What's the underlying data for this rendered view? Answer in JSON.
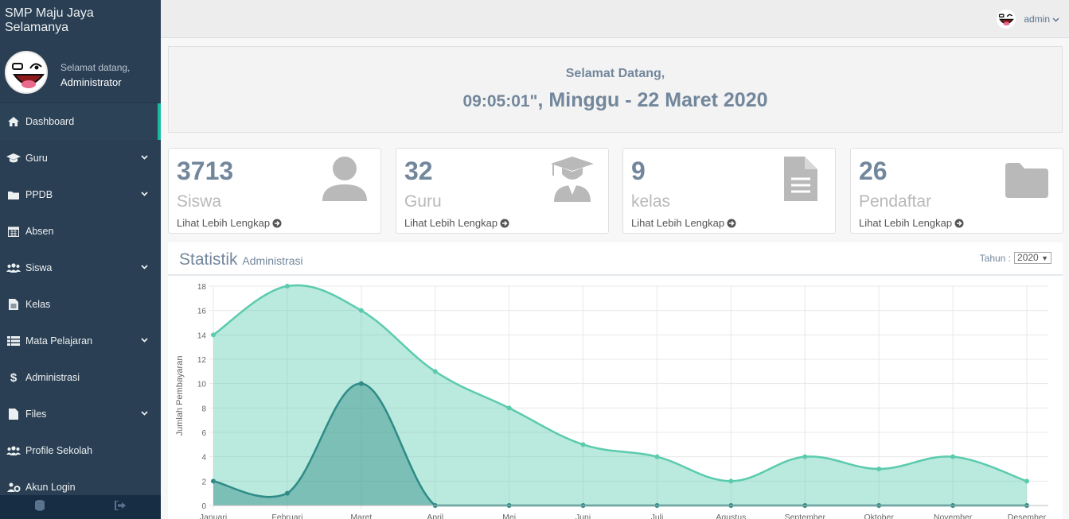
{
  "app": {
    "brand": "SMP Maju Jaya Selamanya"
  },
  "profile": {
    "greeting": "Selamat datang,",
    "name": "Administrator"
  },
  "sidebar": {
    "items": [
      {
        "label": "Dashboard",
        "icon": "home-icon",
        "active": true,
        "has_children": false
      },
      {
        "label": "Guru",
        "icon": "graduation-cap-icon",
        "active": false,
        "has_children": true
      },
      {
        "label": "PPDB",
        "icon": "folder-icon",
        "active": false,
        "has_children": true
      },
      {
        "label": "Absen",
        "icon": "calendar-icon",
        "active": false,
        "has_children": false
      },
      {
        "label": "Siswa",
        "icon": "users-icon",
        "active": false,
        "has_children": true
      },
      {
        "label": "Kelas",
        "icon": "file-text-icon",
        "active": false,
        "has_children": false
      },
      {
        "label": "Mata Pelajaran",
        "icon": "table-icon",
        "active": false,
        "has_children": true
      },
      {
        "label": "Administrasi",
        "icon": "dollar-icon",
        "active": false,
        "has_children": false
      },
      {
        "label": "Files",
        "icon": "file-icon",
        "active": false,
        "has_children": true
      },
      {
        "label": "Profile Sekolah",
        "icon": "users-icon",
        "active": false,
        "has_children": false
      },
      {
        "label": "Akun Login",
        "icon": "users-cog-icon",
        "active": false,
        "has_children": false
      }
    ],
    "footer_icons": [
      "database-icon",
      "sign-out-icon"
    ]
  },
  "topbar": {
    "username": "admin"
  },
  "welcome": {
    "title": "Selamat Datang,",
    "time": "09:05:01\"",
    "date": ", Minggu - 22 Maret 2020"
  },
  "stats": [
    {
      "count": "3713",
      "label": "Siswa",
      "link": "Lihat Lebih Lengkap",
      "icon": "user-icon"
    },
    {
      "count": "32",
      "label": "Guru",
      "link": "Lihat Lebih Lengkap",
      "icon": "graduate-icon"
    },
    {
      "count": "9",
      "label": "kelas",
      "link": "Lihat Lebih Lengkap",
      "icon": "document-icon"
    },
    {
      "count": "26",
      "label": "Pendaftar",
      "link": "Lihat Lebih Lengkap",
      "icon": "folder-icon"
    }
  ],
  "chart_panel": {
    "title": "Statistik",
    "subtitle": "Administrasi",
    "year_label": "Tahun :",
    "year_value": "2020"
  },
  "colors": {
    "sidebar": "#2a3f54",
    "accent": "#1abb9c",
    "series1": "#5bcbae",
    "series2": "#2e8b87"
  },
  "chart_data": {
    "type": "area",
    "categories": [
      "Januari",
      "Februari",
      "Maret",
      "April",
      "Mei",
      "Juni",
      "Juli",
      "Agustus",
      "September",
      "Oktober",
      "November",
      "Desember"
    ],
    "series": [
      {
        "values": [
          14,
          18,
          16,
          11,
          8,
          5,
          4,
          2,
          4,
          3,
          4,
          2
        ]
      },
      {
        "values": [
          2,
          1,
          10,
          0,
          0,
          0,
          0,
          0,
          0,
          0,
          0,
          0
        ]
      }
    ],
    "xlabel": "",
    "ylabel": "Jumlah Pembayaran",
    "ylim": [
      0,
      18
    ],
    "yticks": [
      0,
      2,
      4,
      6,
      8,
      10,
      12,
      14,
      16,
      18
    ],
    "grid": true
  }
}
